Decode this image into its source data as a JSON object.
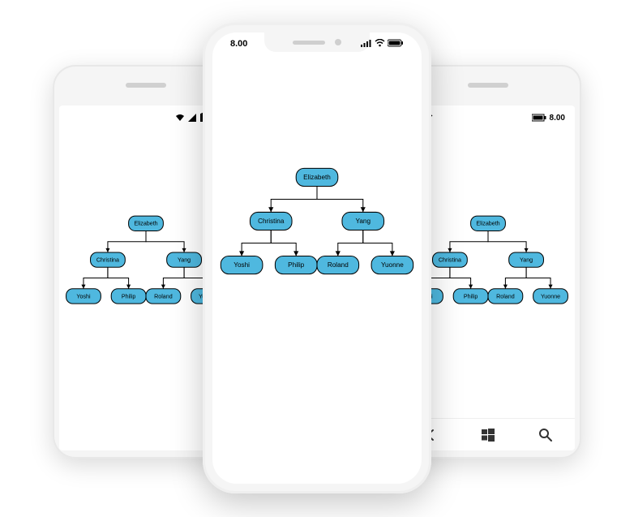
{
  "statusbar": {
    "time": "8.00"
  },
  "diagram": {
    "root": "Elizabeth",
    "level2": [
      "Christina",
      "Yang"
    ],
    "level3": [
      "Yoshi",
      "Philip",
      "Roland",
      "Yuonne"
    ]
  },
  "icons": {
    "wifi": "wifi-icon",
    "signal": "signal-icon",
    "battery": "battery-icon",
    "back": "back-icon",
    "windows": "windows-icon",
    "search": "search-icon"
  }
}
